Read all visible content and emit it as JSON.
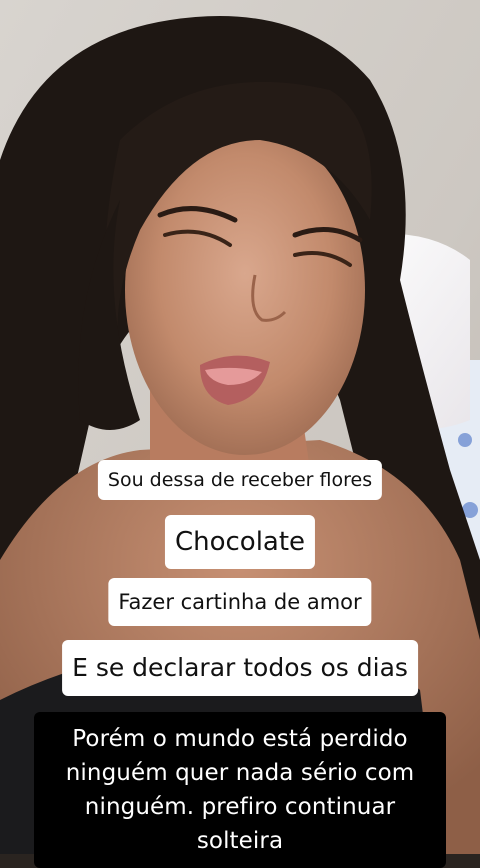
{
  "story": {
    "captions": [
      "Sou dessa de receber flores",
      "Chocolate",
      "Fazer cartinha de amor",
      "E se declarar todos os dias",
      "Porém o mundo está perdido ninguém quer nada sério com ninguém. prefiro continuar solteira"
    ]
  },
  "colors": {
    "caption_bg_light": "#ffffff",
    "caption_bg_dark": "#000000",
    "caption_text_light": "#111111",
    "caption_text_dark": "#ffffff"
  }
}
